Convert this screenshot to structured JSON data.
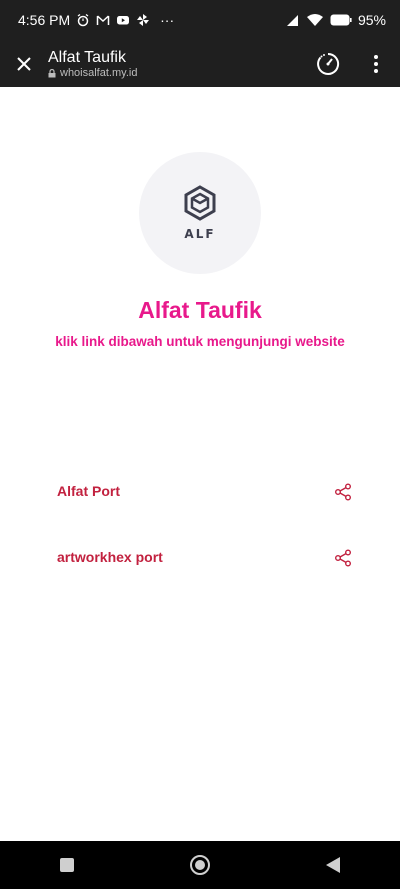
{
  "status_bar": {
    "time": "4:56 PM",
    "notif_icons": [
      "alarm-icon",
      "gmail-icon",
      "youtube-icon",
      "pinwheel-icon"
    ],
    "more": "···",
    "battery": "95%"
  },
  "browser": {
    "title": "Alfat Taufik",
    "url": "whoisalfat.my.id"
  },
  "profile": {
    "logo_text": "ALF",
    "name": "Alfat Taufik",
    "description": "klik link dibawah untuk mengunjungi website"
  },
  "links": [
    {
      "label": "Alfat Port"
    },
    {
      "label": "artworkhex port"
    }
  ],
  "colors": {
    "accent": "#e8198b",
    "link": "#c2213f",
    "avatar_bg": "#f3f3f6",
    "bar_bg": "#1f1f1f"
  }
}
